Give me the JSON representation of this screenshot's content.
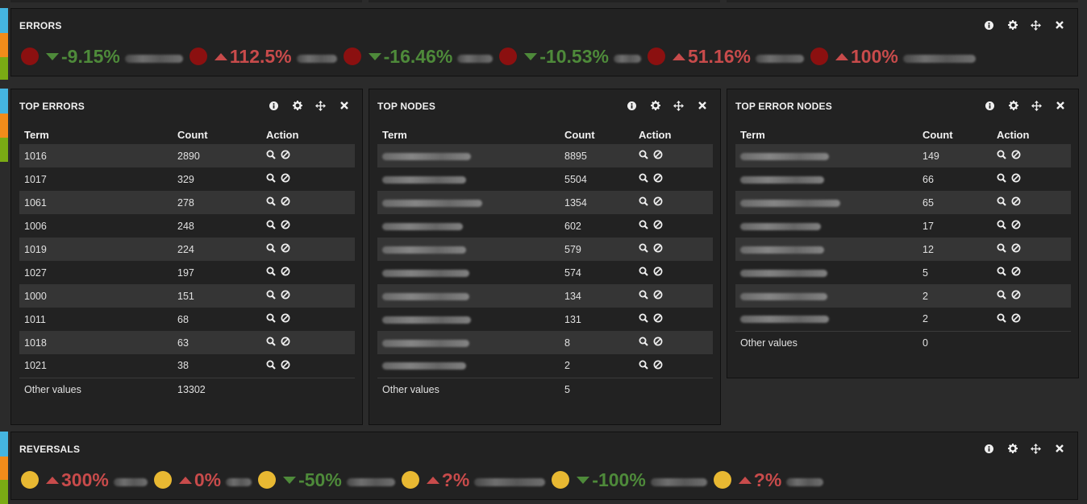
{
  "errors_panel": {
    "title": "ERRORS",
    "items": [
      {
        "direction": "down",
        "value": "-9.15%"
      },
      {
        "direction": "up",
        "value": "112.5%"
      },
      {
        "direction": "down",
        "value": "-16.46%"
      },
      {
        "direction": "down",
        "value": "-10.53%"
      },
      {
        "direction": "up",
        "value": "51.16%"
      },
      {
        "direction": "up",
        "value": "100%"
      }
    ]
  },
  "top_errors": {
    "title": "TOP ERRORS",
    "headers": {
      "term": "Term",
      "count": "Count",
      "action": "Action"
    },
    "rows": [
      {
        "term": "1016",
        "count": "2890"
      },
      {
        "term": "1017",
        "count": "329"
      },
      {
        "term": "1061",
        "count": "278"
      },
      {
        "term": "1006",
        "count": "248"
      },
      {
        "term": "1019",
        "count": "224"
      },
      {
        "term": "1027",
        "count": "197"
      },
      {
        "term": "1000",
        "count": "151"
      },
      {
        "term": "1011",
        "count": "68"
      },
      {
        "term": "1018",
        "count": "63"
      },
      {
        "term": "1021",
        "count": "38"
      }
    ],
    "other": {
      "label": "Other values",
      "count": "13302"
    }
  },
  "top_nodes": {
    "title": "TOP NODES",
    "headers": {
      "term": "Term",
      "count": "Count",
      "action": "Action"
    },
    "rows": [
      {
        "count": "8895"
      },
      {
        "count": "5504"
      },
      {
        "count": "1354"
      },
      {
        "count": "602"
      },
      {
        "count": "579"
      },
      {
        "count": "574"
      },
      {
        "count": "134"
      },
      {
        "count": "131"
      },
      {
        "count": "8"
      },
      {
        "count": "2"
      }
    ],
    "other": {
      "label": "Other values",
      "count": "5"
    }
  },
  "top_error_nodes": {
    "title": "TOP ERROR NODES",
    "headers": {
      "term": "Term",
      "count": "Count",
      "action": "Action"
    },
    "rows": [
      {
        "count": "149"
      },
      {
        "count": "66"
      },
      {
        "count": "65"
      },
      {
        "count": "17"
      },
      {
        "count": "12"
      },
      {
        "count": "5"
      },
      {
        "count": "2"
      },
      {
        "count": "2"
      }
    ],
    "other": {
      "label": "Other values",
      "count": "0"
    }
  },
  "reversals_panel": {
    "title": "REVERSALS",
    "items": [
      {
        "direction": "up",
        "value": "300%"
      },
      {
        "direction": "up",
        "value": "0%"
      },
      {
        "direction": "down",
        "value": "-50%"
      },
      {
        "direction": "up",
        "value": "?%"
      },
      {
        "direction": "down",
        "value": "-100%"
      },
      {
        "direction": "up",
        "value": "?%"
      }
    ]
  },
  "icons": [
    "info-icon",
    "gear-icon",
    "move-icon",
    "close-icon",
    "search-icon",
    "ban-icon"
  ],
  "colors": {
    "up": "#c84b4b",
    "down": "#4e8a3a",
    "error_dot": "#8b1010",
    "reversal_dot": "#e8b832",
    "tab_blue": "#45b5e0",
    "tab_orange": "#f28c1a",
    "tab_green": "#7aab14"
  }
}
